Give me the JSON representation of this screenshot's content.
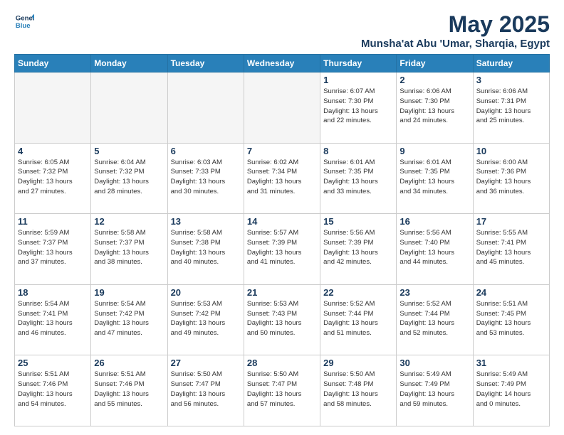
{
  "header": {
    "logo_line1": "General",
    "logo_line2": "Blue",
    "title": "May 2025",
    "subtitle": "Munsha'at Abu 'Umar, Sharqia, Egypt"
  },
  "weekdays": [
    "Sunday",
    "Monday",
    "Tuesday",
    "Wednesday",
    "Thursday",
    "Friday",
    "Saturday"
  ],
  "weeks": [
    [
      {
        "day": "",
        "info": ""
      },
      {
        "day": "",
        "info": ""
      },
      {
        "day": "",
        "info": ""
      },
      {
        "day": "",
        "info": ""
      },
      {
        "day": "1",
        "info": "Sunrise: 6:07 AM\nSunset: 7:30 PM\nDaylight: 13 hours\nand 22 minutes."
      },
      {
        "day": "2",
        "info": "Sunrise: 6:06 AM\nSunset: 7:30 PM\nDaylight: 13 hours\nand 24 minutes."
      },
      {
        "day": "3",
        "info": "Sunrise: 6:06 AM\nSunset: 7:31 PM\nDaylight: 13 hours\nand 25 minutes."
      }
    ],
    [
      {
        "day": "4",
        "info": "Sunrise: 6:05 AM\nSunset: 7:32 PM\nDaylight: 13 hours\nand 27 minutes."
      },
      {
        "day": "5",
        "info": "Sunrise: 6:04 AM\nSunset: 7:32 PM\nDaylight: 13 hours\nand 28 minutes."
      },
      {
        "day": "6",
        "info": "Sunrise: 6:03 AM\nSunset: 7:33 PM\nDaylight: 13 hours\nand 30 minutes."
      },
      {
        "day": "7",
        "info": "Sunrise: 6:02 AM\nSunset: 7:34 PM\nDaylight: 13 hours\nand 31 minutes."
      },
      {
        "day": "8",
        "info": "Sunrise: 6:01 AM\nSunset: 7:35 PM\nDaylight: 13 hours\nand 33 minutes."
      },
      {
        "day": "9",
        "info": "Sunrise: 6:01 AM\nSunset: 7:35 PM\nDaylight: 13 hours\nand 34 minutes."
      },
      {
        "day": "10",
        "info": "Sunrise: 6:00 AM\nSunset: 7:36 PM\nDaylight: 13 hours\nand 36 minutes."
      }
    ],
    [
      {
        "day": "11",
        "info": "Sunrise: 5:59 AM\nSunset: 7:37 PM\nDaylight: 13 hours\nand 37 minutes."
      },
      {
        "day": "12",
        "info": "Sunrise: 5:58 AM\nSunset: 7:37 PM\nDaylight: 13 hours\nand 38 minutes."
      },
      {
        "day": "13",
        "info": "Sunrise: 5:58 AM\nSunset: 7:38 PM\nDaylight: 13 hours\nand 40 minutes."
      },
      {
        "day": "14",
        "info": "Sunrise: 5:57 AM\nSunset: 7:39 PM\nDaylight: 13 hours\nand 41 minutes."
      },
      {
        "day": "15",
        "info": "Sunrise: 5:56 AM\nSunset: 7:39 PM\nDaylight: 13 hours\nand 42 minutes."
      },
      {
        "day": "16",
        "info": "Sunrise: 5:56 AM\nSunset: 7:40 PM\nDaylight: 13 hours\nand 44 minutes."
      },
      {
        "day": "17",
        "info": "Sunrise: 5:55 AM\nSunset: 7:41 PM\nDaylight: 13 hours\nand 45 minutes."
      }
    ],
    [
      {
        "day": "18",
        "info": "Sunrise: 5:54 AM\nSunset: 7:41 PM\nDaylight: 13 hours\nand 46 minutes."
      },
      {
        "day": "19",
        "info": "Sunrise: 5:54 AM\nSunset: 7:42 PM\nDaylight: 13 hours\nand 47 minutes."
      },
      {
        "day": "20",
        "info": "Sunrise: 5:53 AM\nSunset: 7:42 PM\nDaylight: 13 hours\nand 49 minutes."
      },
      {
        "day": "21",
        "info": "Sunrise: 5:53 AM\nSunset: 7:43 PM\nDaylight: 13 hours\nand 50 minutes."
      },
      {
        "day": "22",
        "info": "Sunrise: 5:52 AM\nSunset: 7:44 PM\nDaylight: 13 hours\nand 51 minutes."
      },
      {
        "day": "23",
        "info": "Sunrise: 5:52 AM\nSunset: 7:44 PM\nDaylight: 13 hours\nand 52 minutes."
      },
      {
        "day": "24",
        "info": "Sunrise: 5:51 AM\nSunset: 7:45 PM\nDaylight: 13 hours\nand 53 minutes."
      }
    ],
    [
      {
        "day": "25",
        "info": "Sunrise: 5:51 AM\nSunset: 7:46 PM\nDaylight: 13 hours\nand 54 minutes."
      },
      {
        "day": "26",
        "info": "Sunrise: 5:51 AM\nSunset: 7:46 PM\nDaylight: 13 hours\nand 55 minutes."
      },
      {
        "day": "27",
        "info": "Sunrise: 5:50 AM\nSunset: 7:47 PM\nDaylight: 13 hours\nand 56 minutes."
      },
      {
        "day": "28",
        "info": "Sunrise: 5:50 AM\nSunset: 7:47 PM\nDaylight: 13 hours\nand 57 minutes."
      },
      {
        "day": "29",
        "info": "Sunrise: 5:50 AM\nSunset: 7:48 PM\nDaylight: 13 hours\nand 58 minutes."
      },
      {
        "day": "30",
        "info": "Sunrise: 5:49 AM\nSunset: 7:49 PM\nDaylight: 13 hours\nand 59 minutes."
      },
      {
        "day": "31",
        "info": "Sunrise: 5:49 AM\nSunset: 7:49 PM\nDaylight: 14 hours\nand 0 minutes."
      }
    ]
  ]
}
